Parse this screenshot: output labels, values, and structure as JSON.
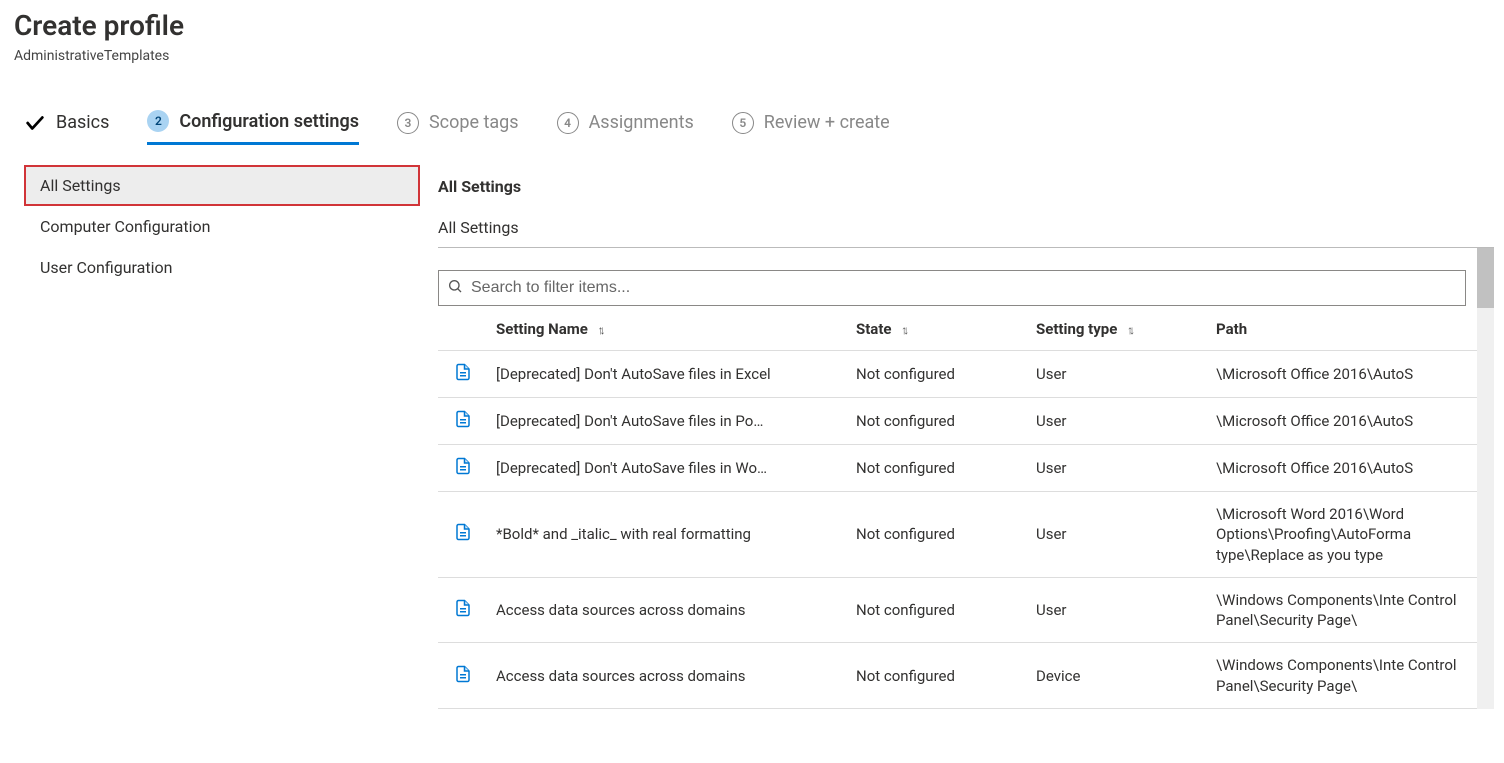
{
  "header": {
    "title": "Create profile",
    "subtitle": "AdministrativeTemplates"
  },
  "steps": {
    "basics": "Basics",
    "config": "Configuration settings",
    "scope": "Scope tags",
    "assign": "Assignments",
    "review": "Review + create",
    "num2": "2",
    "num3": "3",
    "num4": "4",
    "num5": "5"
  },
  "sidebar": {
    "items": [
      {
        "label": "All Settings"
      },
      {
        "label": "Computer Configuration"
      },
      {
        "label": "User Configuration"
      }
    ]
  },
  "content": {
    "heading": "All Settings",
    "breadcrumb": "All Settings"
  },
  "search": {
    "placeholder": "Search to filter items..."
  },
  "table": {
    "headers": {
      "name": "Setting Name",
      "state": "State",
      "type": "Setting type",
      "path": "Path"
    },
    "rows": [
      {
        "name": "[Deprecated] Don't AutoSave files in Excel",
        "state": "Not configured",
        "type": "User",
        "path": "\\Microsoft Office 2016\\AutoS"
      },
      {
        "name": "[Deprecated] Don't AutoSave files in Po…",
        "state": "Not configured",
        "type": "User",
        "path": "\\Microsoft Office 2016\\AutoS"
      },
      {
        "name": "[Deprecated] Don't AutoSave files in Wo…",
        "state": "Not configured",
        "type": "User",
        "path": "\\Microsoft Office 2016\\AutoS"
      },
      {
        "name": "*Bold* and _italic_ with real formatting",
        "state": "Not configured",
        "type": "User",
        "path": "\\Microsoft Word 2016\\Word Options\\Proofing\\AutoForma type\\Replace as you type"
      },
      {
        "name": "Access data sources across domains",
        "state": "Not configured",
        "type": "User",
        "path": "\\Windows Components\\Inte Control Panel\\Security Page\\"
      },
      {
        "name": "Access data sources across domains",
        "state": "Not configured",
        "type": "Device",
        "path": "\\Windows Components\\Inte Control Panel\\Security Page\\"
      }
    ]
  }
}
